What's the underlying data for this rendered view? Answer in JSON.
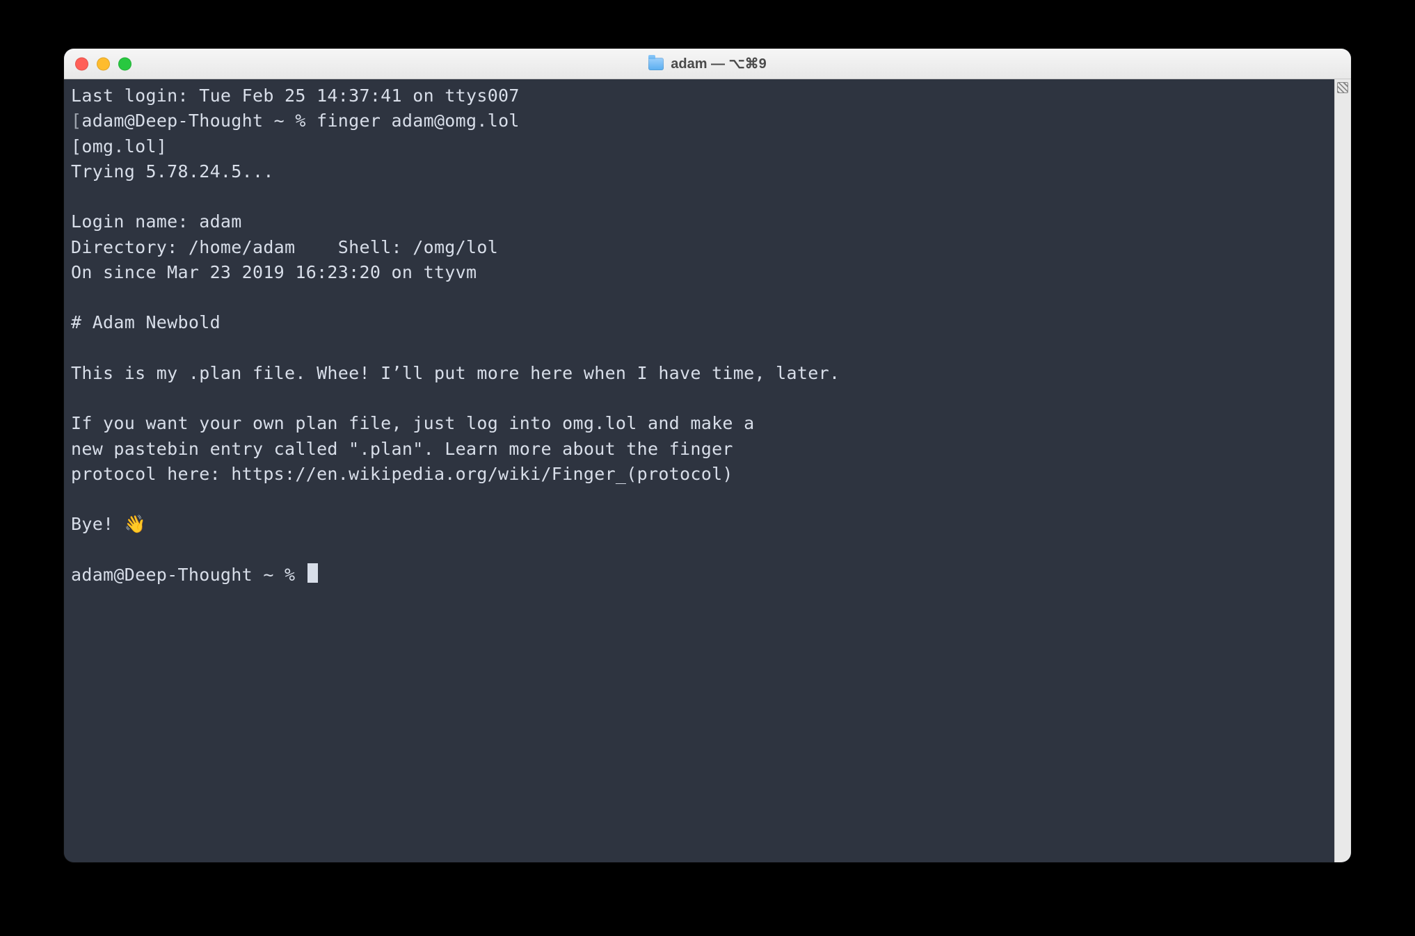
{
  "window": {
    "title": "adam — ⌥⌘9"
  },
  "terminal": {
    "last_login": "Last login: Tue Feb 25 14:37:41 on ttys007",
    "prompt1_prefix": "[",
    "prompt1": "adam@Deep-Thought ~ % ",
    "command1": "finger adam@omg.lol",
    "prompt1_suffix": "]",
    "out_host": "[omg.lol]",
    "out_trying": "Trying 5.78.24.5...",
    "out_login": "Login name: adam",
    "out_dirshell": "Directory: /home/adam    Shell: /omg/lol",
    "out_onsince": "On since Mar 23 2019 16:23:20 on ttyvm",
    "plan_heading": "# Adam Newbold",
    "plan_p1": "This is my .plan file. Whee! I’ll put more here when I have time, later.",
    "plan_p2_l1": "If you want your own plan file, just log into omg.lol and make a",
    "plan_p2_l2": "new pastebin entry called \".plan\". Learn more about the finger",
    "plan_p2_l3": "protocol here: https://en.wikipedia.org/wiki/Finger_(protocol)",
    "plan_bye": "Bye! 👋",
    "prompt2": "adam@Deep-Thought ~ % "
  }
}
